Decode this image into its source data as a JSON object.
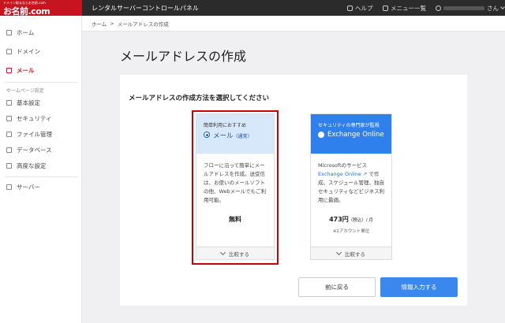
{
  "header": {
    "logo_tagline": "ドメイン取るならお名前.com",
    "logo_text": "お名前.com",
    "panel_title": "レンタルサーバーコントロールパネル",
    "help_label": "ヘルプ",
    "menu_label": "メニュー一覧",
    "user_suffix": "さん"
  },
  "sidebar": {
    "items": [
      {
        "label": "ホーム",
        "icon": "home-icon"
      },
      {
        "label": "ドメイン",
        "icon": "domain-icon"
      },
      {
        "label": "メール",
        "icon": "mail-icon",
        "active": true
      }
    ],
    "section_label": "ホームページ設定",
    "settings": [
      {
        "label": "基本設定",
        "icon": "monitor-icon"
      },
      {
        "label": "セキュリティ",
        "icon": "shield-icon"
      },
      {
        "label": "ファイル管理",
        "icon": "file-icon"
      },
      {
        "label": "データベース",
        "icon": "database-icon"
      },
      {
        "label": "高度な設定",
        "icon": "advanced-settings-icon"
      }
    ],
    "server_label": "サーバー"
  },
  "breadcrumb": {
    "home": "ホーム",
    "separator": ">",
    "current": "メールアドレスの作成"
  },
  "page": {
    "title": "メールアドレスの作成",
    "heading": "メールアドレスの作成方法を選択してください"
  },
  "options": [
    {
      "badge": "簡単利用におすすめ",
      "name": "メール",
      "name_sub": "（通常）",
      "selected": true,
      "desc": "フローに沿って簡単にメールアドレスを作成。送受信は、お使いのメールソフトの他、Webメールでもご利用可能。",
      "price": "無料",
      "compare": "比較する"
    },
    {
      "badge": "セキュリティの専門家が監視",
      "name": "Exchange Online",
      "selected": false,
      "desc_pre": "Microsoftのサービス",
      "desc_link": "Exchange Online",
      "desc_post": "で作成。スケジュール管理、独自セキュリティなどビジネス利用に最適。",
      "price": "473円",
      "price_tax": "（税込）/ 月",
      "note": "※1アカウント単位",
      "compare": "比較する"
    }
  ],
  "buttons": {
    "back": "前に戻る",
    "next": "情報入力する"
  },
  "colors": {
    "brand": "#c8141e",
    "primary": "#3a88ee",
    "header_bg": "#2b2b2b",
    "highlight_border": "#cc0000"
  }
}
